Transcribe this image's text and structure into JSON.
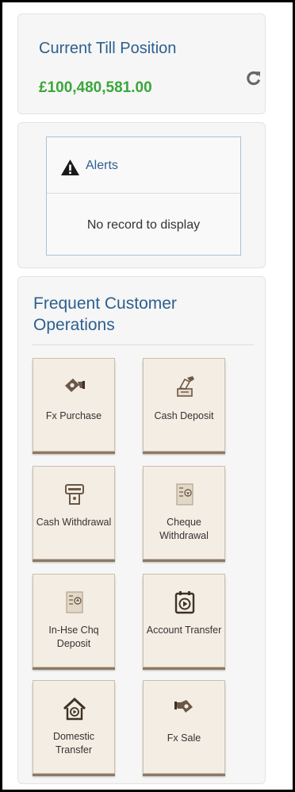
{
  "till": {
    "title": "Current Till Position",
    "amount": "£100,480,581.00",
    "amount_color": "#3aa63a",
    "refresh_icon": "refresh-icon"
  },
  "alerts": {
    "title": "Alerts",
    "icon": "warning-icon",
    "empty_message": "No record to display"
  },
  "operations": {
    "title": "Frequent Customer Operations",
    "tiles": [
      {
        "label": "Fx Purchase",
        "icon": "fx-purchase-icon"
      },
      {
        "label": "Cash Deposit",
        "icon": "cash-deposit-icon"
      },
      {
        "label": "Cash Withdrawal",
        "icon": "cash-withdrawal-icon"
      },
      {
        "label": "Cheque Withdrawal",
        "icon": "cheque-withdrawal-icon"
      },
      {
        "label": "In-Hse Chq Deposit",
        "icon": "inhouse-cheque-deposit-icon"
      },
      {
        "label": "Account Transfer",
        "icon": "account-transfer-icon"
      },
      {
        "label": "Domestic Transfer",
        "icon": "domestic-transfer-icon"
      },
      {
        "label": "Fx Sale",
        "icon": "fx-sale-icon"
      }
    ]
  },
  "colors": {
    "title_blue": "#2c5f8f",
    "tile_bg": "#f4ede3",
    "tile_shadow": "#8c7a62",
    "icon_brown": "#6b5846"
  }
}
